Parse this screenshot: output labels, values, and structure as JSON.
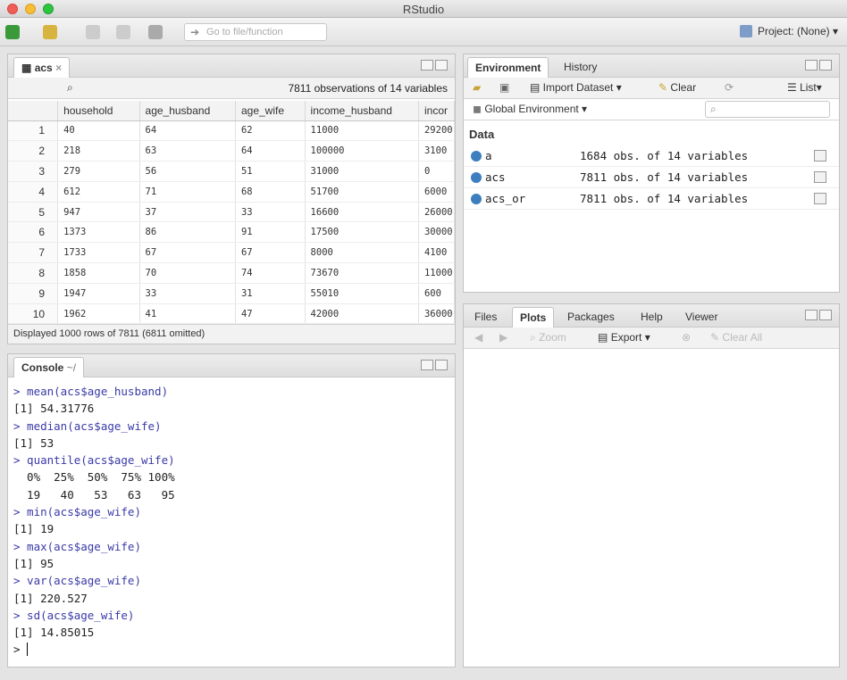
{
  "window": {
    "title": "RStudio"
  },
  "toolbar": {
    "goto_placeholder": "Go to file/function",
    "project": "Project: (None)"
  },
  "data_viewer": {
    "tab": "acs",
    "summary": "7811 observations of 14 variables",
    "columns": [
      "household",
      "age_husband",
      "age_wife",
      "income_husband",
      "incor"
    ],
    "rows": [
      [
        "1",
        "40",
        "64",
        "62",
        "11000",
        "29200"
      ],
      [
        "2",
        "218",
        "63",
        "64",
        "100000",
        "3100"
      ],
      [
        "3",
        "279",
        "56",
        "51",
        "31000",
        "0"
      ],
      [
        "4",
        "612",
        "71",
        "68",
        "51700",
        "6000"
      ],
      [
        "5",
        "947",
        "37",
        "33",
        "16600",
        "26000"
      ],
      [
        "6",
        "1373",
        "86",
        "91",
        "17500",
        "30000"
      ],
      [
        "7",
        "1733",
        "67",
        "67",
        "8000",
        "4100"
      ],
      [
        "8",
        "1858",
        "70",
        "74",
        "73670",
        "11000"
      ],
      [
        "9",
        "1947",
        "33",
        "31",
        "55010",
        "600"
      ],
      [
        "10",
        "1962",
        "41",
        "47",
        "42000",
        "36000"
      ]
    ],
    "status": "Displayed 1000 rows of 7811 (6811 omitted)"
  },
  "console": {
    "tab": "Console",
    "path": "~/",
    "lines": [
      {
        "text": "> mean(acs$age_husband)",
        "kind": "cmd"
      },
      {
        "text": "[1] 54.31776",
        "kind": "out"
      },
      {
        "text": "> median(acs$age_wife)",
        "kind": "cmd"
      },
      {
        "text": "[1] 53",
        "kind": "out"
      },
      {
        "text": "> quantile(acs$age_wife)",
        "kind": "cmd"
      },
      {
        "text": "  0%  25%  50%  75% 100% ",
        "kind": "out"
      },
      {
        "text": "  19   40   53   63   95 ",
        "kind": "out"
      },
      {
        "text": "> min(acs$age_wife)",
        "kind": "cmd"
      },
      {
        "text": "[1] 19",
        "kind": "out"
      },
      {
        "text": "> max(acs$age_wife)",
        "kind": "cmd"
      },
      {
        "text": "[1] 95",
        "kind": "out"
      },
      {
        "text": "> var(acs$age_wife)",
        "kind": "cmd"
      },
      {
        "text": "[1] 220.527",
        "kind": "out"
      },
      {
        "text": "> sd(acs$age_wife)",
        "kind": "cmd"
      },
      {
        "text": "[1] 14.85015",
        "kind": "out"
      }
    ],
    "prompt": ">"
  },
  "environment": {
    "tabs": [
      "Environment",
      "History"
    ],
    "import_label": "Import Dataset",
    "clear_label": "Clear",
    "list_label": "List",
    "scope": "Global Environment",
    "section": "Data",
    "items": [
      {
        "name": "a",
        "desc": "1684 obs. of 14 variables"
      },
      {
        "name": "acs",
        "desc": "7811 obs. of 14 variables"
      },
      {
        "name": "acs_or",
        "desc": "7811 obs. of 14 variables"
      }
    ]
  },
  "files": {
    "tabs": [
      "Files",
      "Plots",
      "Packages",
      "Help",
      "Viewer"
    ],
    "zoom_label": "Zoom",
    "export_label": "Export",
    "clear_all_label": "Clear All"
  }
}
